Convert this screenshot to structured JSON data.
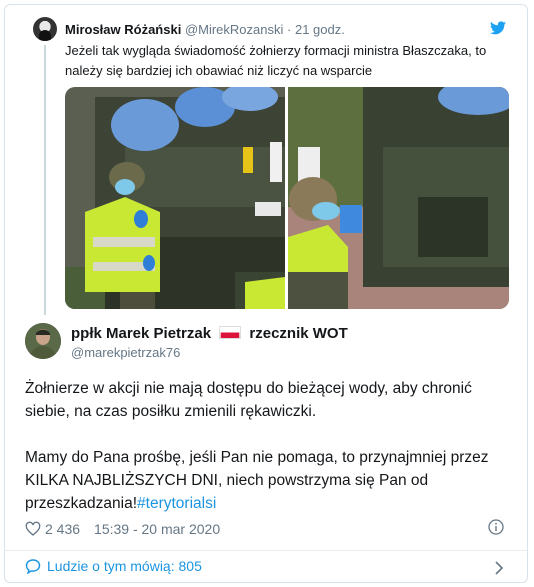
{
  "quoted_tweet": {
    "author_name": "Mirosław Różański",
    "author_handle": "@MirekRozanski",
    "separator": "·",
    "time": "21 godz.",
    "text": "Jeżeli tak wygląda świadomość żołnierzy formacji ministra Błaszczaka, to należy się bardziej ich obawiać niż liczyć na wsparcie",
    "icon": "twitter-bird-icon"
  },
  "tweet": {
    "author_name": "ppłk Marek Pietrzak",
    "author_role": "rzecznik WOT",
    "author_handle": "@marekpietrzak76",
    "paragraph_1": "Żołnierze w akcji nie mają dostępu do bieżącej wody, aby chronić siebie, na czas posiłku zmienili rękawiczki.",
    "paragraph_2_text": "Mamy do Pana prośbę, jeśli Pan nie pomaga, to przynajmniej przez KILKA NAJBLIŻSZYCH DNI, niech powstrzyma się Pan od przeszkadzania!",
    "hashtag": "#terytorialsi",
    "like_count": "2 436",
    "timestamp": "15:39 - 20 mar 2020"
  },
  "footer": {
    "people_talking": "Ludzie o tym mówią: 805"
  },
  "colors": {
    "link": "#1b95e0",
    "muted": "#657786",
    "text": "#14171a",
    "border": "#d9e2e8"
  }
}
